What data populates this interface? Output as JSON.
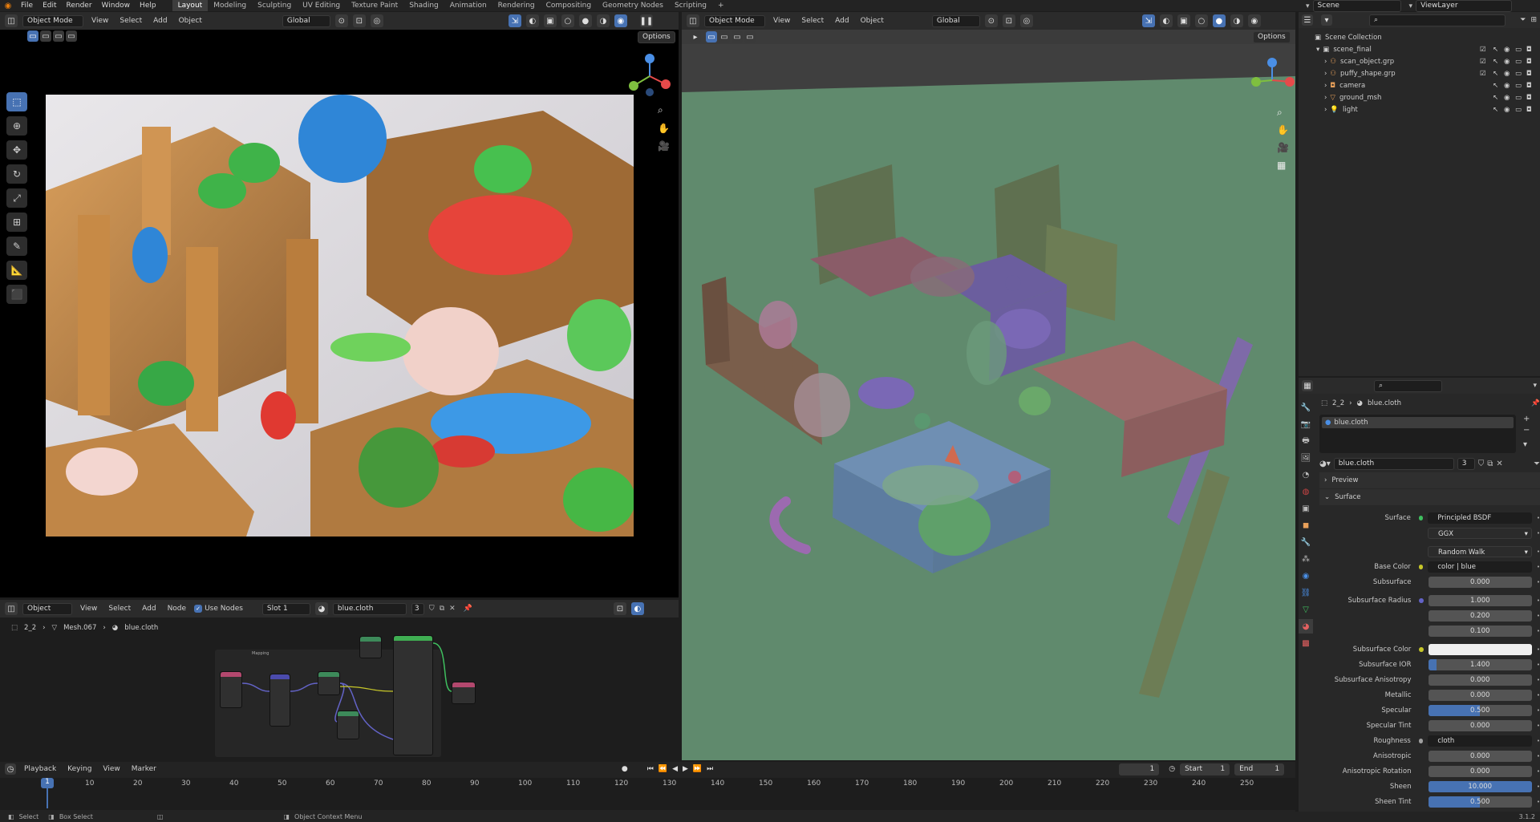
{
  "topbar": {
    "menus": [
      "File",
      "Edit",
      "Render",
      "Window",
      "Help"
    ],
    "workspaces": [
      "Layout",
      "Modeling",
      "Sculpting",
      "UV Editing",
      "Texture Paint",
      "Shading",
      "Animation",
      "Rendering",
      "Compositing",
      "Geometry Nodes",
      "Scripting"
    ],
    "active_workspace": "Layout",
    "scene": "Scene",
    "view_layer": "ViewLayer"
  },
  "left_view": {
    "mode": "Object Mode",
    "menus": [
      "View",
      "Select",
      "Add",
      "Object"
    ],
    "orientation": "Global",
    "options": "Options"
  },
  "right_view": {
    "mode": "Object Mode",
    "menus": [
      "View",
      "Select",
      "Add",
      "Object"
    ],
    "orientation": "Global",
    "options": "Options"
  },
  "node_editor": {
    "type": "Object",
    "menus": [
      "View",
      "Select",
      "Add",
      "Node"
    ],
    "use_nodes": "Use Nodes",
    "slot": "Slot 1",
    "material": "blue.cloth",
    "users": "3",
    "breadcrumb": [
      "2_2",
      "Mesh.067",
      "blue.cloth"
    ],
    "mapping_label": "Mapping"
  },
  "timeline": {
    "menus": [
      "Playback",
      "Keying",
      "View",
      "Marker"
    ],
    "current_frame": "1",
    "start_label": "Start",
    "start": "1",
    "end_label": "End",
    "end": "1",
    "ticks": [
      "10",
      "20",
      "30",
      "40",
      "50",
      "60",
      "70",
      "80",
      "90",
      "100",
      "110",
      "120",
      "130",
      "140",
      "150",
      "160",
      "170",
      "180",
      "190",
      "200",
      "210",
      "220",
      "230",
      "240",
      "250"
    ],
    "playhead": "1"
  },
  "status": {
    "select": "Select",
    "box_select": "Box Select",
    "context": "Object Context Menu",
    "version": "3.1.2"
  },
  "outliner": {
    "root": "Scene Collection",
    "collection": "scene_final",
    "items": [
      {
        "name": "scan_object.grp",
        "color": "#e8a05a"
      },
      {
        "name": "puffy_shape.grp",
        "color": "#e8a05a"
      },
      {
        "name": "camera",
        "color": "#e8a05a"
      },
      {
        "name": "ground_msh",
        "color": "#e8a05a"
      },
      {
        "name": "light",
        "color": "#e8a05a"
      }
    ]
  },
  "properties": {
    "breadcrumb": [
      "2_2",
      "blue.cloth"
    ],
    "slot_material": "blue.cloth",
    "material": "blue.cloth",
    "users": "3",
    "preview": "Preview",
    "surface_section": "Surface",
    "rows": [
      {
        "label": "Surface",
        "value": "Principled BSDF",
        "kind": "link",
        "dot": "#3fbf5f"
      },
      {
        "label": "",
        "value": "GGX",
        "kind": "enum"
      },
      {
        "label": "",
        "value": "Random Walk",
        "kind": "enum"
      },
      {
        "label": "Base Color",
        "value": "color | blue",
        "kind": "link",
        "dot": "#c7c729"
      },
      {
        "label": "Subsurface",
        "value": "0.000",
        "kind": "num",
        "fill": 0
      },
      {
        "label": "Subsurface Radius",
        "value": "1.000",
        "kind": "num",
        "fill": 0,
        "dot": "#6363c7"
      },
      {
        "label": "",
        "value": "0.200",
        "kind": "num",
        "fill": 0
      },
      {
        "label": "",
        "value": "0.100",
        "kind": "num",
        "fill": 0
      },
      {
        "label": "Subsurface Color",
        "value": "",
        "kind": "color",
        "dot": "#c7c729"
      },
      {
        "label": "Subsurface IOR",
        "value": "1.400",
        "kind": "num",
        "fill": 0.08
      },
      {
        "label": "Subsurface Anisotropy",
        "value": "0.000",
        "kind": "num",
        "fill": 0
      },
      {
        "label": "Metallic",
        "value": "0.000",
        "kind": "num",
        "fill": 0
      },
      {
        "label": "Specular",
        "value": "0.500",
        "kind": "num",
        "fill": 0.5
      },
      {
        "label": "Specular Tint",
        "value": "0.000",
        "kind": "num",
        "fill": 0
      },
      {
        "label": "Roughness",
        "value": "cloth",
        "kind": "link",
        "dot": "#a0a0a0"
      },
      {
        "label": "Anisotropic",
        "value": "0.000",
        "kind": "num",
        "fill": 0
      },
      {
        "label": "Anisotropic Rotation",
        "value": "0.000",
        "kind": "num",
        "fill": 0
      },
      {
        "label": "Sheen",
        "value": "10.000",
        "kind": "num",
        "fill": 1
      },
      {
        "label": "Sheen Tint",
        "value": "0.500",
        "kind": "num",
        "fill": 0.5
      }
    ]
  }
}
